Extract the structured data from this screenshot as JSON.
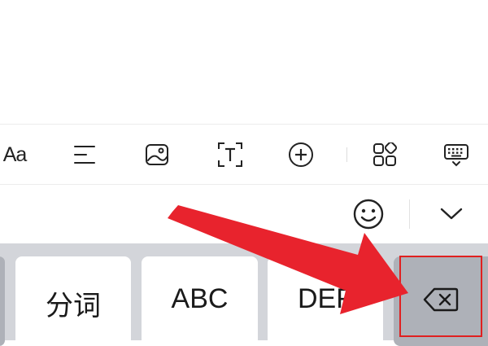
{
  "toolbar": {
    "items": [
      {
        "name": "font-style",
        "label": "Aa"
      },
      {
        "name": "align"
      },
      {
        "name": "image"
      },
      {
        "name": "text-box"
      },
      {
        "name": "insert"
      },
      {
        "name": "apps"
      },
      {
        "name": "keyboard"
      }
    ]
  },
  "candidate_bar": {
    "emoji_icon": "smiley-icon",
    "collapse_icon": "chevron-down-icon"
  },
  "keyboard": {
    "keys": [
      {
        "id": "fenci",
        "label": "分词"
      },
      {
        "id": "abc",
        "label": "ABC"
      },
      {
        "id": "def",
        "label": "DEF"
      }
    ],
    "delete_icon": "backspace-icon"
  },
  "annotation": {
    "color": "#e02020",
    "arrow_target": "delete-key"
  }
}
